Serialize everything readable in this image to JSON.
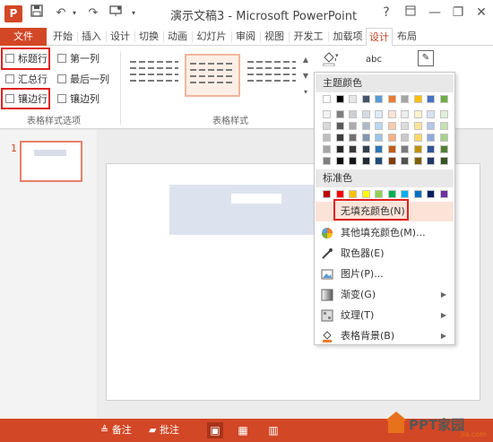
{
  "title_bar": {
    "app_icon": "P",
    "quick_access": {
      "save_icon": "save-icon",
      "undo_icon": "undo-icon",
      "slideshow_icon": "slideshow-icon"
    },
    "document_title": "演示文稿3 - Microsoft PowerPoint",
    "help": "?",
    "minimize": "—",
    "restore": "❐",
    "close": "✕"
  },
  "tabs": [
    {
      "label": "文件"
    },
    {
      "label": "开始"
    },
    {
      "label": "插入"
    },
    {
      "label": "设计"
    },
    {
      "label": "切换"
    },
    {
      "label": "动画"
    },
    {
      "label": "幻灯片"
    },
    {
      "label": "审阅"
    },
    {
      "label": "视图"
    },
    {
      "label": "开发工"
    },
    {
      "label": "加载项"
    },
    {
      "label": "设计"
    },
    {
      "label": "布局"
    }
  ],
  "active_tab_index": 11,
  "table_style_options": {
    "options": [
      {
        "label": "标题行",
        "checked": false
      },
      {
        "label": "第一列",
        "checked": false
      },
      {
        "label": "汇总行",
        "checked": false
      },
      {
        "label": "最后一列",
        "checked": false
      },
      {
        "label": "镶边行",
        "checked": false
      },
      {
        "label": "镶边列",
        "checked": false
      }
    ],
    "group_label": "表格样式选项"
  },
  "table_styles": {
    "group_label": "表格样式",
    "selected_index": 1,
    "shading_icon": "paint-bucket-icon",
    "wordart_label": "abc",
    "draw_table_icon": "draw-table-icon"
  },
  "shading_menu": {
    "theme_colors_header": "主题颜色",
    "standard_colors_header": "标准色",
    "theme_top_row": [
      "#ffffff",
      "#000000",
      "#e7e6e6",
      "#44546a",
      "#5b9bd5",
      "#ed7d31",
      "#a5a5a5",
      "#ffc000",
      "#4472c4",
      "#70ad47"
    ],
    "theme_shades": [
      [
        "#f2f2f2",
        "#7f7f7f",
        "#d0cece",
        "#d6dce4",
        "#deebf6",
        "#fbe5d5",
        "#ededed",
        "#fff2cc",
        "#d9e2f3",
        "#e2efd9"
      ],
      [
        "#d8d8d8",
        "#595959",
        "#aeaaaa",
        "#adb9ca",
        "#bdd7ee",
        "#f7cbac",
        "#dbdbdb",
        "#fee599",
        "#b4c6e7",
        "#c5e0b3"
      ],
      [
        "#bfbfbf",
        "#3f3f3f",
        "#757070",
        "#8496b0",
        "#9cc3e5",
        "#f4b183",
        "#c9c9c9",
        "#ffd965",
        "#8eaadb",
        "#a8d08d"
      ],
      [
        "#a5a5a5",
        "#262626",
        "#3a3838",
        "#323f4f",
        "#2e75b5",
        "#c55a11",
        "#7b7b7b",
        "#bf9000",
        "#2f5496",
        "#538135"
      ],
      [
        "#7f7f7f",
        "#0c0c0c",
        "#171616",
        "#222a35",
        "#1e4e79",
        "#833c0b",
        "#525252",
        "#7f6000",
        "#1f3864",
        "#375623"
      ]
    ],
    "standard_colors": [
      "#c00000",
      "#ff0000",
      "#ffc000",
      "#ffff00",
      "#92d050",
      "#00b050",
      "#00b0f0",
      "#0070c0",
      "#002060",
      "#7030a0"
    ],
    "items": [
      {
        "label": "无填充颜色(N)",
        "icon": "no-fill-icon"
      },
      {
        "label": "其他填充颜色(M)...",
        "icon": "color-wheel-icon"
      },
      {
        "label": "取色器(E)",
        "icon": "eyedropper-icon"
      },
      {
        "label": "图片(P)...",
        "icon": "picture-icon"
      },
      {
        "label": "渐变(G)",
        "icon": "gradient-icon"
      },
      {
        "label": "纹理(T)",
        "icon": "texture-icon"
      },
      {
        "label": "表格背景(B)",
        "icon": "table-background-icon"
      }
    ]
  },
  "slides_pane": {
    "slide_number": "1"
  },
  "status_bar": {
    "notes_label": "备注",
    "comments_label": "批注"
  },
  "watermark": {
    "text": "PPT家园",
    "sub": "jia.com"
  }
}
